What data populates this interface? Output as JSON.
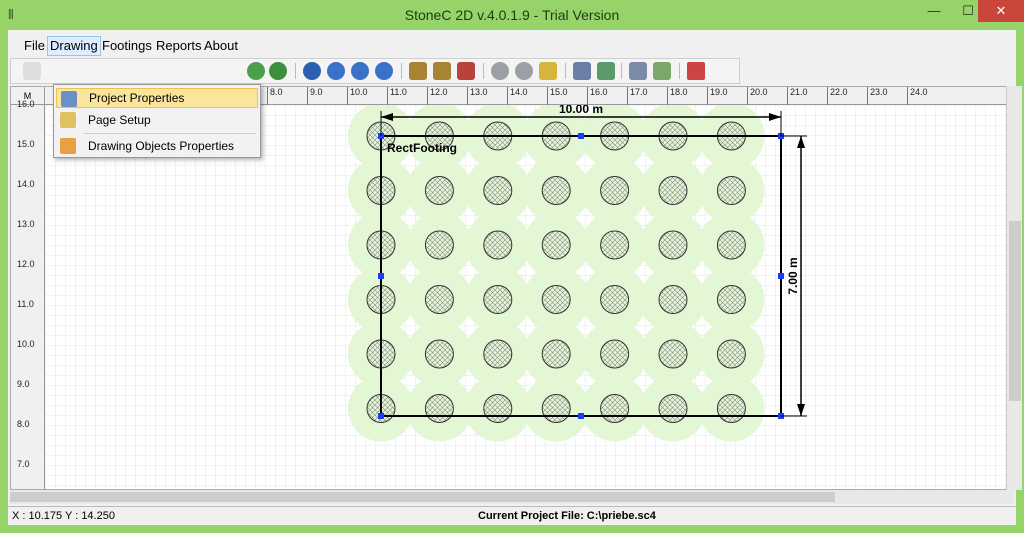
{
  "window": {
    "title": "StoneC 2D v.4.0.1.9 - Trial Version",
    "minimize": "—",
    "maximize": "☐",
    "close": "✕"
  },
  "menubar": {
    "items": [
      "File",
      "Drawing",
      "Footings",
      "Reports",
      "About"
    ],
    "active": "Drawing"
  },
  "drawing_menu": {
    "items": [
      "Project Properties",
      "Page Setup",
      "Drawing Objects Properties"
    ]
  },
  "ruler": {
    "corner": "M",
    "h_ticks": [
      "7.0",
      "8.0",
      "9.0",
      "10.0",
      "11.0",
      "12.0",
      "13.0",
      "14.0",
      "15.0",
      "16.0",
      "17.0",
      "18.0",
      "19.0",
      "20.0",
      "21.0",
      "22.0",
      "23.0",
      "24.0"
    ],
    "v_ticks": [
      "16.0",
      "15.0",
      "14.0",
      "13.0",
      "12.0",
      "11.0",
      "10.0",
      "9.0",
      "8.0",
      "7.0"
    ]
  },
  "drawing": {
    "footing_label": "RectFooting",
    "width_dim": "10.00 m",
    "height_dim": "7.00 m",
    "columns": 7,
    "rows": 6
  },
  "statusbar": {
    "coords": "X : 10.175  Y : 14.250",
    "project_file": "Current Project File: C:\\priebe.sc4"
  }
}
